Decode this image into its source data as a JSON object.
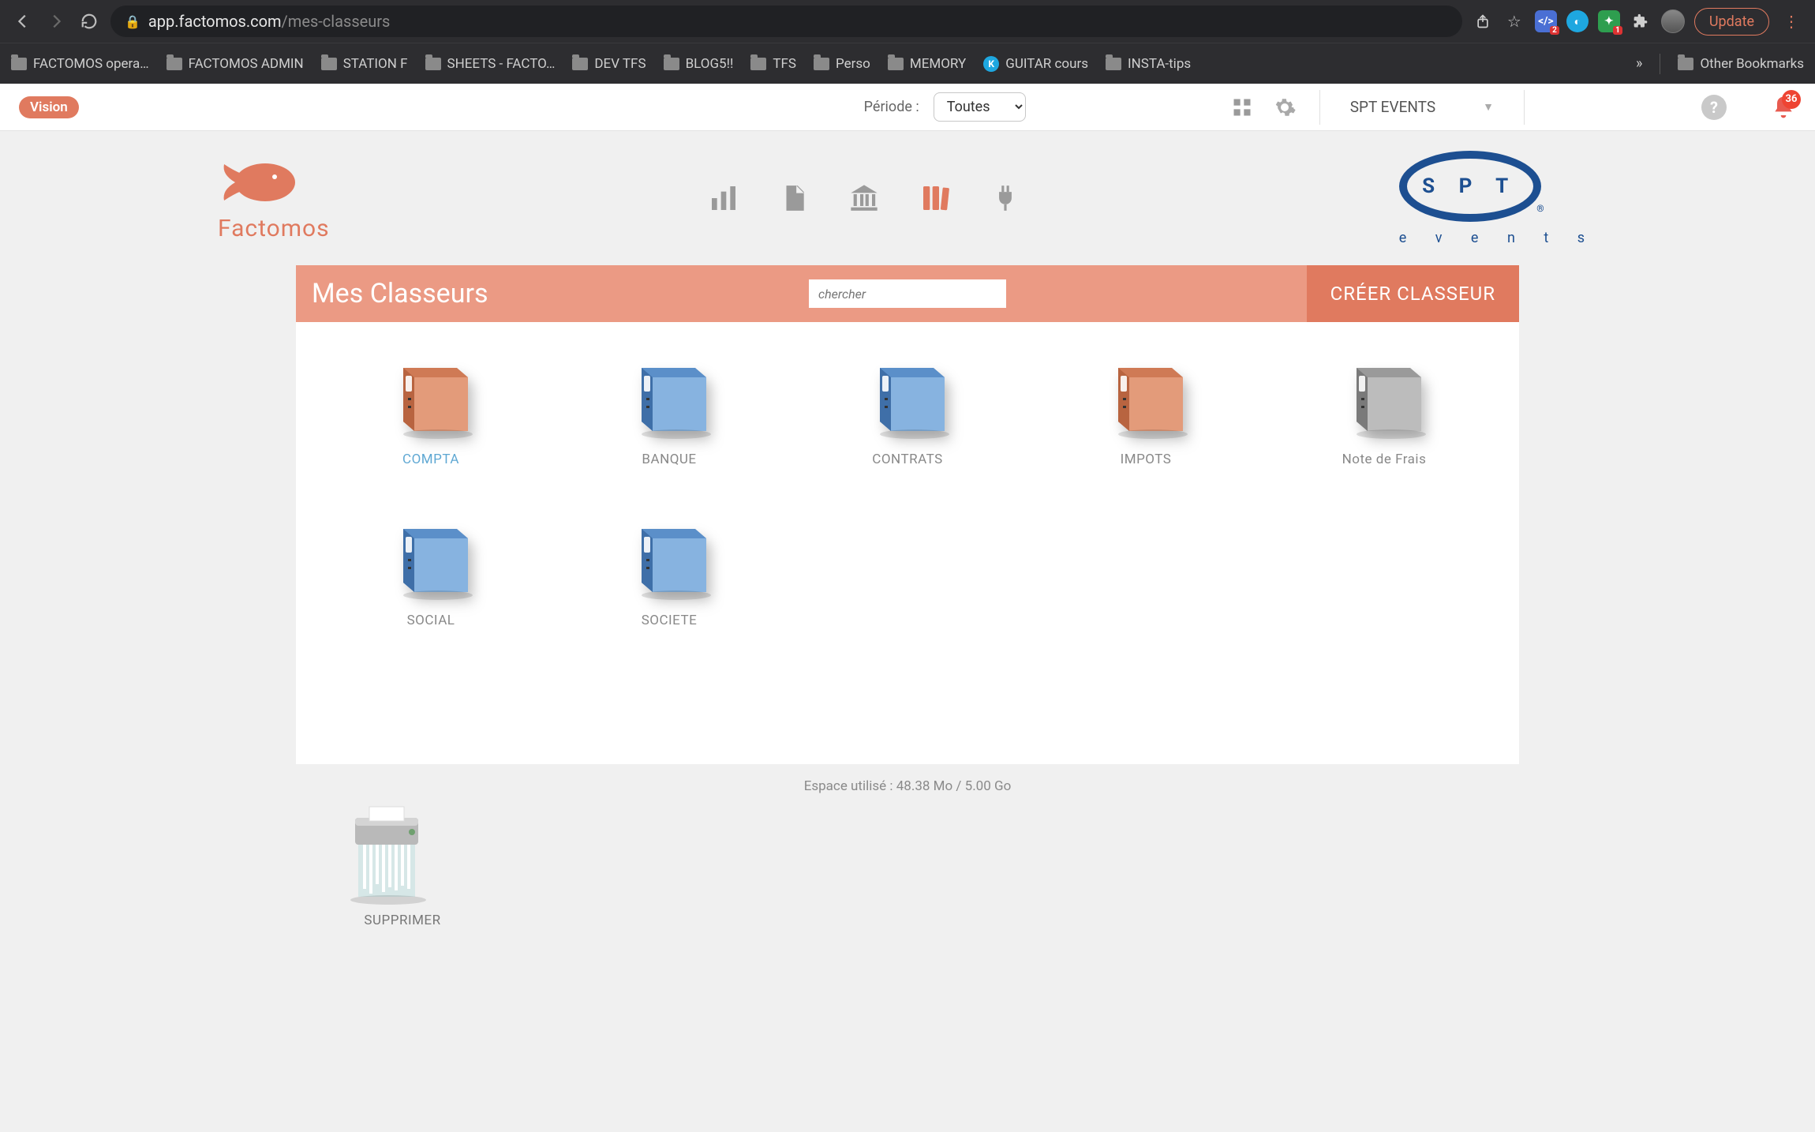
{
  "browser": {
    "url_host": "app.factomos.com",
    "url_path": "/mes-classeurs",
    "update_label": "Update",
    "bookmarks": [
      {
        "label": "FACTOMOS opera…",
        "type": "folder"
      },
      {
        "label": "FACTOMOS ADMIN",
        "type": "folder"
      },
      {
        "label": "STATION F",
        "type": "folder"
      },
      {
        "label": "SHEETS - FACTO…",
        "type": "folder"
      },
      {
        "label": "DEV TFS",
        "type": "folder"
      },
      {
        "label": "BLOG5!!",
        "type": "folder"
      },
      {
        "label": "TFS",
        "type": "folder"
      },
      {
        "label": "Perso",
        "type": "folder"
      },
      {
        "label": "MEMORY",
        "type": "folder"
      },
      {
        "label": "GUITAR cours",
        "type": "site"
      },
      {
        "label": "INSTA-tips",
        "type": "folder"
      }
    ],
    "other_bookmarks": "Other Bookmarks"
  },
  "topbar": {
    "vision_label": "Vision",
    "periode_label": "Période :",
    "periode_value": "Toutes",
    "account_name": "SPT EVENTS",
    "notification_count": "36"
  },
  "brand": {
    "app_name": "Factomos",
    "client_name_top": "S P T",
    "client_name_bottom": "e v e n t s"
  },
  "module": {
    "title": "Mes Classeurs",
    "search_placeholder": "chercher",
    "create_label": "CRÉER CLASSEUR",
    "storage_line": "Espace utilisé : 48.38 Mo / 5.00 Go",
    "trash_label": "SUPPRIMER"
  },
  "binders": [
    {
      "label": "COMPTA",
      "color": "orange",
      "active": true
    },
    {
      "label": "BANQUE",
      "color": "blue",
      "active": false
    },
    {
      "label": "CONTRATS",
      "color": "blue",
      "active": false
    },
    {
      "label": "IMPOTS",
      "color": "orange",
      "active": false
    },
    {
      "label": "Note de Frais",
      "color": "gray",
      "active": false
    },
    {
      "label": "SOCIAL",
      "color": "blue",
      "active": false
    },
    {
      "label": "SOCIETE",
      "color": "blue",
      "active": false
    }
  ]
}
